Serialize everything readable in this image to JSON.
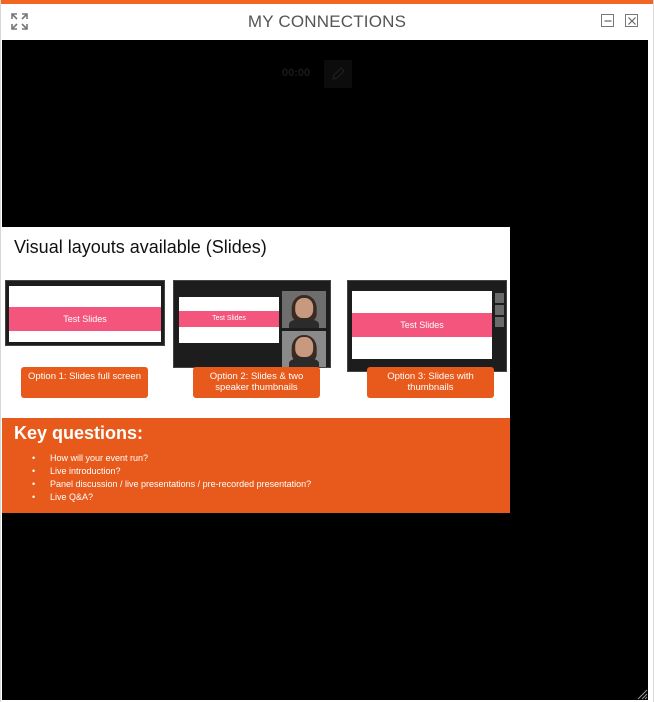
{
  "window": {
    "title": "MY CONNECTIONS",
    "accent_color": "#f26522",
    "expand_icon": "expand-arrows-icon",
    "minimize_icon": "minimize-icon",
    "close_icon": "close-icon"
  },
  "stage": {
    "timer": "00:00"
  },
  "slide": {
    "heading": "Visual layouts available (Slides)",
    "options": [
      {
        "thumb_label": "Test Slides",
        "button_label": "Option 1: Slides full screen"
      },
      {
        "thumb_label": "Test Slides",
        "button_label": "Option 2: Slides & two speaker thumbnails"
      },
      {
        "thumb_label": "Test Slides",
        "button_label": "Option 3: Slides with thumbnails"
      }
    ],
    "key_title": "Key questions:",
    "key_items": [
      "How will your event run?",
      "Live introduction?",
      "Panel discussion / live presentations / pre-recorded presentation?",
      "Live Q&A?"
    ],
    "brand_orange": "#e85a1c",
    "brand_pink": "#f4557c"
  }
}
